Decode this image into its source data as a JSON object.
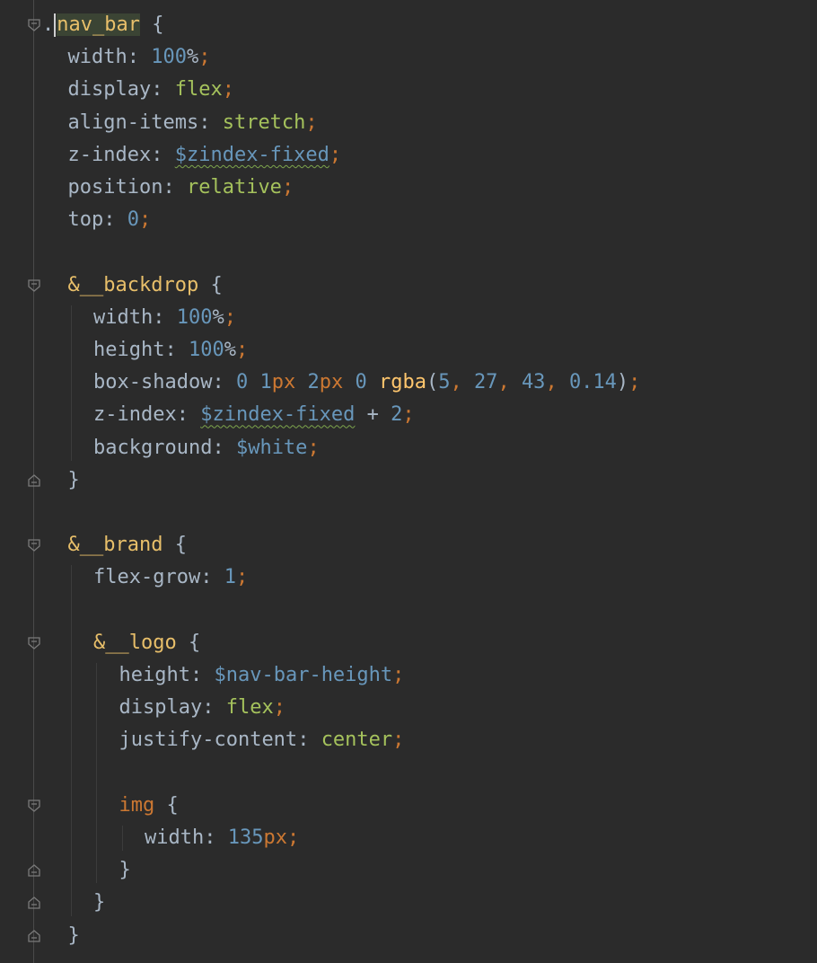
{
  "colors": {
    "background": "#2b2b2b",
    "selector": "#e8bf6a",
    "property": "#a9b7c6",
    "number": "#6897bb",
    "keyword": "#a5c25c",
    "punctuation": "#cc7832",
    "function": "#ffc66d"
  },
  "lines": [
    {
      "fold": "open",
      "tokens": [
        {
          "t": ".",
          "c": "plain"
        },
        {
          "t": "nav_bar",
          "c": "selhl"
        },
        {
          "t": " ",
          "c": "plain"
        },
        {
          "t": "{",
          "c": "plain"
        }
      ]
    },
    {
      "tokens": [
        {
          "t": "width",
          "c": "prop"
        },
        {
          "t": ": ",
          "c": "plain"
        },
        {
          "t": "100",
          "c": "num"
        },
        {
          "t": "%",
          "c": "plain"
        },
        {
          "t": ";",
          "c": "punc"
        }
      ]
    },
    {
      "tokens": [
        {
          "t": "display",
          "c": "prop"
        },
        {
          "t": ": ",
          "c": "plain"
        },
        {
          "t": "flex",
          "c": "kw"
        },
        {
          "t": ";",
          "c": "punc"
        }
      ]
    },
    {
      "tokens": [
        {
          "t": "align-items",
          "c": "prop"
        },
        {
          "t": ": ",
          "c": "plain"
        },
        {
          "t": "stretch",
          "c": "kw"
        },
        {
          "t": ";",
          "c": "punc"
        }
      ]
    },
    {
      "tokens": [
        {
          "t": "z-index",
          "c": "prop"
        },
        {
          "t": ": ",
          "c": "plain"
        },
        {
          "t": "$zindex-fixed",
          "c": "varsq"
        },
        {
          "t": ";",
          "c": "punc"
        }
      ]
    },
    {
      "tokens": [
        {
          "t": "position",
          "c": "prop"
        },
        {
          "t": ": ",
          "c": "plain"
        },
        {
          "t": "relative",
          "c": "kw"
        },
        {
          "t": ";",
          "c": "punc"
        }
      ]
    },
    {
      "tokens": [
        {
          "t": "top",
          "c": "prop"
        },
        {
          "t": ": ",
          "c": "plain"
        },
        {
          "t": "0",
          "c": "num"
        },
        {
          "t": ";",
          "c": "punc"
        }
      ]
    },
    {
      "tokens": []
    },
    {
      "fold": "open",
      "tokens": [
        {
          "t": "&__backdrop",
          "c": "sel"
        },
        {
          "t": " ",
          "c": "plain"
        },
        {
          "t": "{",
          "c": "plain"
        }
      ]
    },
    {
      "tokens": [
        {
          "t": "width",
          "c": "prop"
        },
        {
          "t": ": ",
          "c": "plain"
        },
        {
          "t": "100",
          "c": "num"
        },
        {
          "t": "%",
          "c": "plain"
        },
        {
          "t": ";",
          "c": "punc"
        }
      ]
    },
    {
      "tokens": [
        {
          "t": "height",
          "c": "prop"
        },
        {
          "t": ": ",
          "c": "plain"
        },
        {
          "t": "100",
          "c": "num"
        },
        {
          "t": "%",
          "c": "plain"
        },
        {
          "t": ";",
          "c": "punc"
        }
      ]
    },
    {
      "tokens": [
        {
          "t": "box-shadow",
          "c": "prop"
        },
        {
          "t": ": ",
          "c": "plain"
        },
        {
          "t": "0",
          "c": "num"
        },
        {
          "t": " ",
          "c": "plain"
        },
        {
          "t": "1",
          "c": "num"
        },
        {
          "t": "px",
          "c": "punc"
        },
        {
          "t": " ",
          "c": "plain"
        },
        {
          "t": "2",
          "c": "num"
        },
        {
          "t": "px",
          "c": "punc"
        },
        {
          "t": " ",
          "c": "plain"
        },
        {
          "t": "0",
          "c": "num"
        },
        {
          "t": " ",
          "c": "plain"
        },
        {
          "t": "rgba",
          "c": "fn"
        },
        {
          "t": "(",
          "c": "plain"
        },
        {
          "t": "5",
          "c": "num"
        },
        {
          "t": ", ",
          "c": "punc"
        },
        {
          "t": "27",
          "c": "num"
        },
        {
          "t": ", ",
          "c": "punc"
        },
        {
          "t": "43",
          "c": "num"
        },
        {
          "t": ", ",
          "c": "punc"
        },
        {
          "t": "0.14",
          "c": "num"
        },
        {
          "t": ")",
          "c": "plain"
        },
        {
          "t": ";",
          "c": "punc"
        }
      ]
    },
    {
      "tokens": [
        {
          "t": "z-index",
          "c": "prop"
        },
        {
          "t": ": ",
          "c": "plain"
        },
        {
          "t": "$zindex-fixed",
          "c": "varsq"
        },
        {
          "t": " + ",
          "c": "plain"
        },
        {
          "t": "2",
          "c": "num"
        },
        {
          "t": ";",
          "c": "punc"
        }
      ]
    },
    {
      "tokens": [
        {
          "t": "background",
          "c": "prop"
        },
        {
          "t": ": ",
          "c": "plain"
        },
        {
          "t": "$white",
          "c": "var"
        },
        {
          "t": ";",
          "c": "punc"
        }
      ]
    },
    {
      "fold": "close",
      "tokens": [
        {
          "t": "}",
          "c": "plain"
        }
      ]
    },
    {
      "tokens": []
    },
    {
      "fold": "open",
      "tokens": [
        {
          "t": "&__brand",
          "c": "sel"
        },
        {
          "t": " ",
          "c": "plain"
        },
        {
          "t": "{",
          "c": "plain"
        }
      ]
    },
    {
      "tokens": [
        {
          "t": "flex-grow",
          "c": "prop"
        },
        {
          "t": ": ",
          "c": "plain"
        },
        {
          "t": "1",
          "c": "num"
        },
        {
          "t": ";",
          "c": "punc"
        }
      ]
    },
    {
      "tokens": []
    },
    {
      "fold": "open",
      "tokens": [
        {
          "t": "&__logo",
          "c": "sel"
        },
        {
          "t": " ",
          "c": "plain"
        },
        {
          "t": "{",
          "c": "plain"
        }
      ]
    },
    {
      "tokens": [
        {
          "t": "height",
          "c": "prop"
        },
        {
          "t": ": ",
          "c": "plain"
        },
        {
          "t": "$nav-bar-height",
          "c": "var"
        },
        {
          "t": ";",
          "c": "punc"
        }
      ]
    },
    {
      "tokens": [
        {
          "t": "display",
          "c": "prop"
        },
        {
          "t": ": ",
          "c": "plain"
        },
        {
          "t": "flex",
          "c": "kw"
        },
        {
          "t": ";",
          "c": "punc"
        }
      ]
    },
    {
      "tokens": [
        {
          "t": "justify-content",
          "c": "prop"
        },
        {
          "t": ": ",
          "c": "plain"
        },
        {
          "t": "center",
          "c": "kw"
        },
        {
          "t": ";",
          "c": "punc"
        }
      ]
    },
    {
      "tokens": []
    },
    {
      "fold": "open",
      "tokens": [
        {
          "t": "img",
          "c": "tag"
        },
        {
          "t": " ",
          "c": "plain"
        },
        {
          "t": "{",
          "c": "plain"
        }
      ]
    },
    {
      "tokens": [
        {
          "t": "width",
          "c": "prop"
        },
        {
          "t": ": ",
          "c": "plain"
        },
        {
          "t": "135",
          "c": "num"
        },
        {
          "t": "px",
          "c": "punc"
        },
        {
          "t": ";",
          "c": "punc"
        }
      ]
    },
    {
      "fold": "close",
      "tokens": [
        {
          "t": "}",
          "c": "plain"
        }
      ]
    },
    {
      "fold": "close",
      "tokens": [
        {
          "t": "}",
          "c": "plain"
        }
      ]
    },
    {
      "fold": "close",
      "tokens": [
        {
          "t": "}",
          "c": "plain"
        }
      ]
    }
  ]
}
